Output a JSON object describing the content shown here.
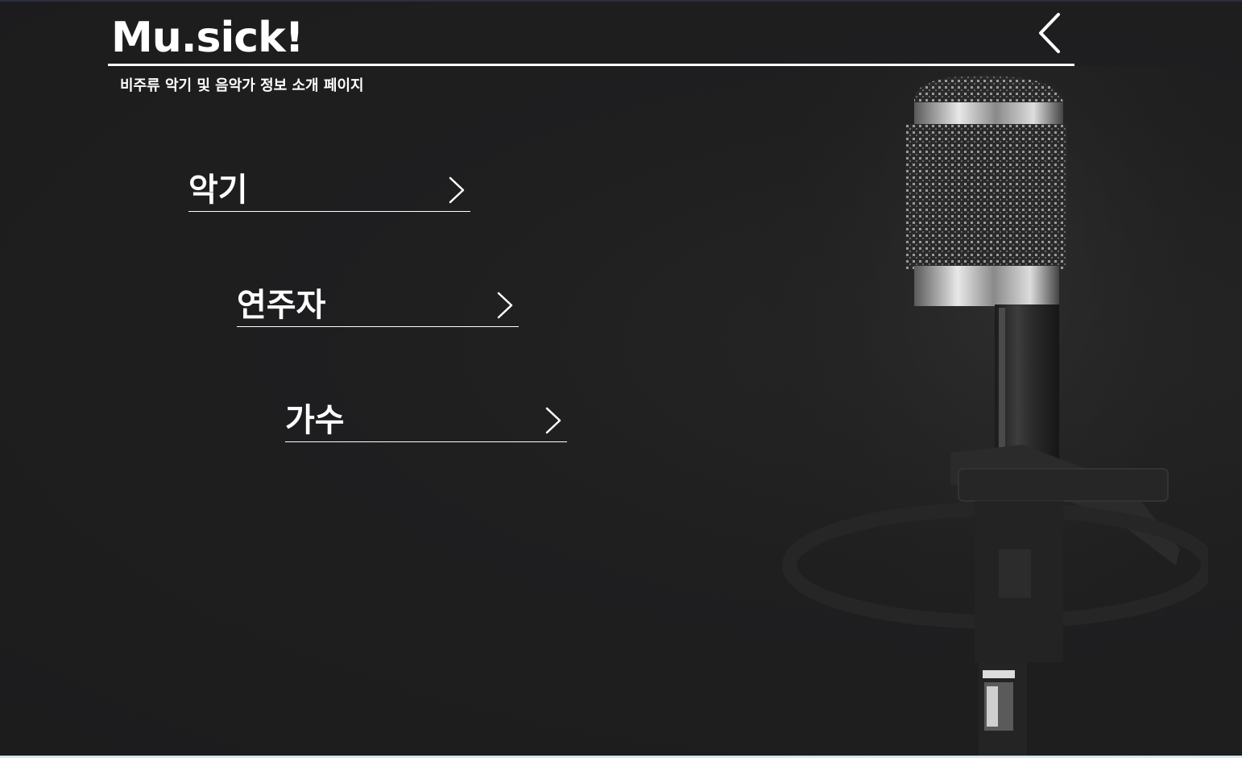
{
  "header": {
    "logo": "Mu.sick!",
    "subtitle": "비주류 악기 및 음악가 정보 소개 페이지",
    "back_icon": "chevron-left-icon"
  },
  "menu": {
    "items": [
      {
        "label": "악기",
        "icon": "chevron-right-icon"
      },
      {
        "label": "연주자",
        "icon": "chevron-right-icon"
      },
      {
        "label": "가수",
        "icon": "chevron-right-icon"
      }
    ]
  },
  "colors": {
    "background": "#1e1e1f",
    "text": "#ffffff"
  }
}
